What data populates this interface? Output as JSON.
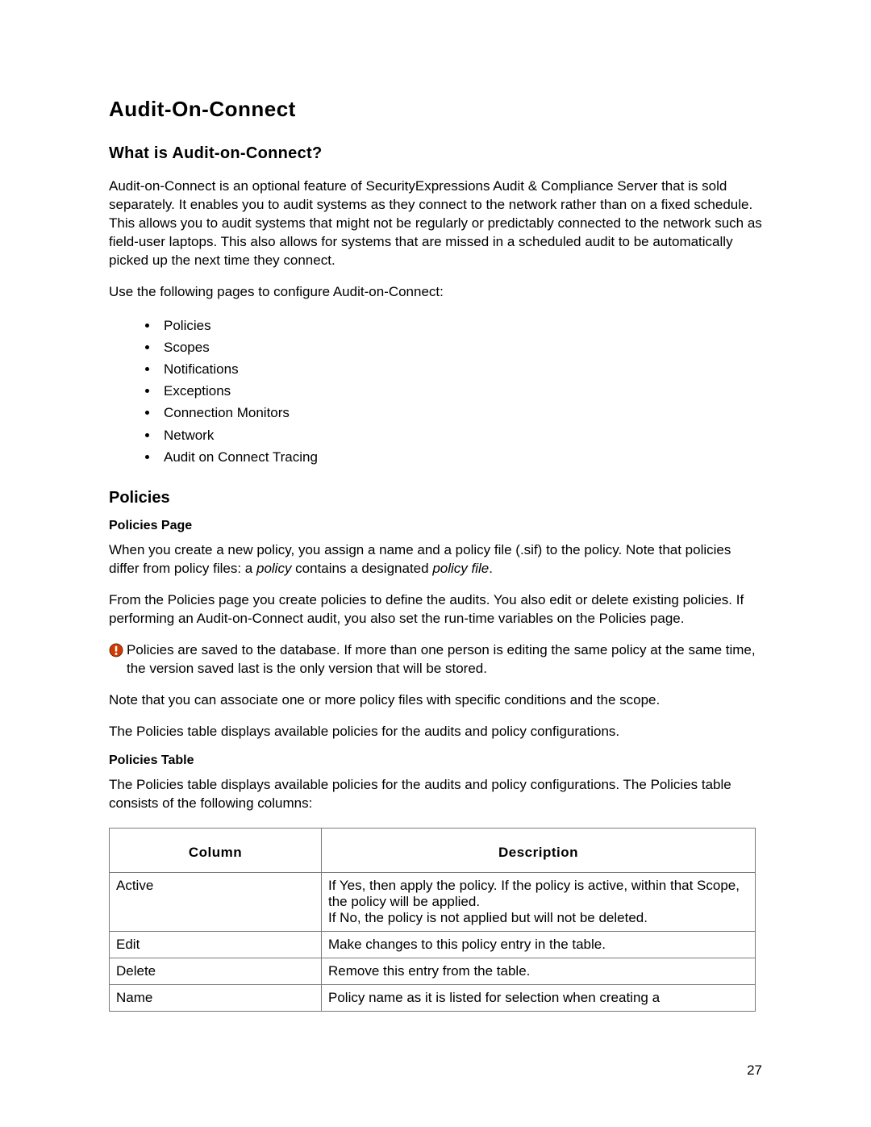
{
  "title": "Audit-On-Connect",
  "subtitle": "What is Audit-on-Connect?",
  "intro_para": "Audit-on-Connect is an optional feature of SecurityExpressions Audit & Compliance Server that is sold separately. It enables you to audit systems as they connect to the network rather than on a fixed schedule. This allows you to audit systems that might not be regularly or predictably connected to the network such as field-user laptops. This also allows for systems that are missed in a scheduled audit to be automatically picked up the next time they connect.",
  "configure_intro": "Use the following pages to configure Audit-on-Connect:",
  "config_items": [
    "Policies",
    "Scopes",
    "Notifications",
    "Exceptions",
    "Connection Monitors",
    "Network",
    "Audit on Connect Tracing"
  ],
  "policies_heading": "Policies",
  "policies_page_heading": "Policies Page",
  "policies_para1_a": "When you create a new policy, you assign a name and a policy file (.sif) to the policy. Note that policies differ from policy files: a ",
  "policies_para1_b": "policy",
  "policies_para1_c": " contains a designated ",
  "policies_para1_d": "policy file",
  "policies_para1_e": ".",
  "policies_para2": "From the Policies page you create policies to define the audits. You also edit or delete existing policies. If performing an Audit-on-Connect audit, you also set the run-time variables on the Policies page.",
  "policies_note": "Policies are saved to the database. If more than one person is editing the same policy at the same time, the version saved last is the only version that will be stored.",
  "policies_para3": "Note that you can associate one or more policy files with specific conditions and the scope.",
  "policies_para4": "The Policies table displays available policies for the audits and policy configurations.",
  "policies_table_heading": "Policies Table",
  "policies_table_intro": "The Policies table displays available policies for the audits and policy configurations. The Policies table consists of the following columns:",
  "table": {
    "headers": [
      "Column",
      "Description"
    ],
    "rows": [
      {
        "col": "Active",
        "desc": "If Yes, then apply the policy. If the policy is active, within that Scope, the policy will be applied.\nIf No, the policy is not applied but will not be deleted."
      },
      {
        "col": "Edit",
        "desc": "Make changes to this policy entry in the table."
      },
      {
        "col": "Delete",
        "desc": "Remove this entry from the table."
      },
      {
        "col": "Name",
        "desc": "Policy name as it is listed for selection when creating a"
      }
    ]
  },
  "page_number": "27"
}
